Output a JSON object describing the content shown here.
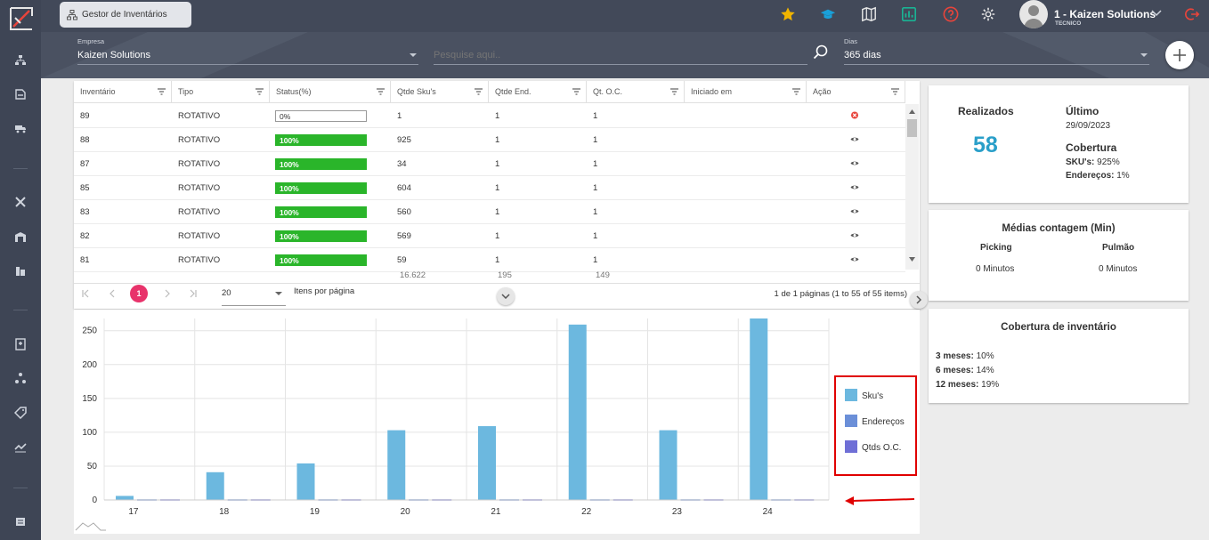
{
  "topbar": {
    "tab_label": "Gestor de Inventários",
    "user_name": "1 - Kaizen Solutions",
    "user_role": "TECNICO",
    "colors": {
      "star": "#f0b400",
      "grad": "#1aa0d8",
      "report": "#1ab394",
      "help": "#e8443b",
      "logout": "#e8443b"
    }
  },
  "filters": {
    "empresa_label": "Empresa",
    "empresa_value": "Kaizen Solutions",
    "search_placeholder": "Pesquise aqui..",
    "dias_label": "Dias",
    "dias_value": "365 dias"
  },
  "table": {
    "headers": [
      "Inventário",
      "Tipo",
      "Status(%)",
      "Qtde Sku's",
      "Qtde End.",
      "Qt. O.C.",
      "Iniciado em",
      "Ação"
    ],
    "rows": [
      {
        "inv": "89",
        "tipo": "ROTATIVO",
        "status": "0%",
        "full": false,
        "sku": "1",
        "end": "1",
        "oc": "1",
        "acao": "cancel"
      },
      {
        "inv": "88",
        "tipo": "ROTATIVO",
        "status": "100%",
        "full": true,
        "sku": "925",
        "end": "1",
        "oc": "1",
        "acao": "view"
      },
      {
        "inv": "87",
        "tipo": "ROTATIVO",
        "status": "100%",
        "full": true,
        "sku": "34",
        "end": "1",
        "oc": "1",
        "acao": "view"
      },
      {
        "inv": "85",
        "tipo": "ROTATIVO",
        "status": "100%",
        "full": true,
        "sku": "604",
        "end": "1",
        "oc": "1",
        "acao": "view"
      },
      {
        "inv": "83",
        "tipo": "ROTATIVO",
        "status": "100%",
        "full": true,
        "sku": "560",
        "end": "1",
        "oc": "1",
        "acao": "view"
      },
      {
        "inv": "82",
        "tipo": "ROTATIVO",
        "status": "100%",
        "full": true,
        "sku": "569",
        "end": "1",
        "oc": "1",
        "acao": "view"
      },
      {
        "inv": "81",
        "tipo": "ROTATIVO",
        "status": "100%",
        "full": true,
        "sku": "59",
        "end": "1",
        "oc": "1",
        "acao": "view"
      }
    ],
    "totals": {
      "sku": "16.622",
      "end": "195",
      "oc": "149"
    }
  },
  "pager": {
    "current_page": "1",
    "page_size": "20",
    "per_page_label": "Itens por página",
    "summary": "1 de 1 páginas (1 to 55 of 55 items)"
  },
  "chart_data": {
    "type": "bar",
    "categories": [
      "17",
      "18",
      "19",
      "20",
      "21",
      "22",
      "23",
      "24"
    ],
    "series": [
      {
        "name": "Sku's",
        "color": "#6cb8df",
        "values": [
          6,
          41,
          54,
          103,
          109,
          259,
          103,
          268
        ]
      },
      {
        "name": "Endereços",
        "color": "#6b8fd8",
        "values": [
          1,
          1,
          1,
          1,
          1,
          1,
          1,
          1
        ]
      },
      {
        "name": "Qtds O.C.",
        "color": "#6f6fd6",
        "values": [
          1,
          1,
          1,
          1,
          1,
          1,
          1,
          1
        ]
      }
    ],
    "yticks": [
      "0",
      "50",
      "100",
      "150",
      "200",
      "250"
    ],
    "ylim": [
      0,
      268
    ],
    "grid": true,
    "legend": "right"
  },
  "annotation_color": "#e00000",
  "cards": {
    "realizados_label": "Realizados",
    "realizados_value": "58",
    "ultimo_label": "Último",
    "ultimo_date": "29/09/2023",
    "cobertura_label": "Cobertura",
    "skus_label": "SKU's:",
    "skus_value": "925%",
    "end_label": "Endereços:",
    "end_value": "1%",
    "medias_title": "Médias contagem (Min)",
    "picking_label": "Picking",
    "picking_value": "0 Minutos",
    "pulmao_label": "Pulmão",
    "pulmao_value": "0 Minutos",
    "cob_title": "Cobertura de inventário",
    "m3_label": "3 meses:",
    "m3_value": "10%",
    "m6_label": "6 meses:",
    "m6_value": "14%",
    "m12_label": "12 meses:",
    "m12_value": "19%"
  }
}
